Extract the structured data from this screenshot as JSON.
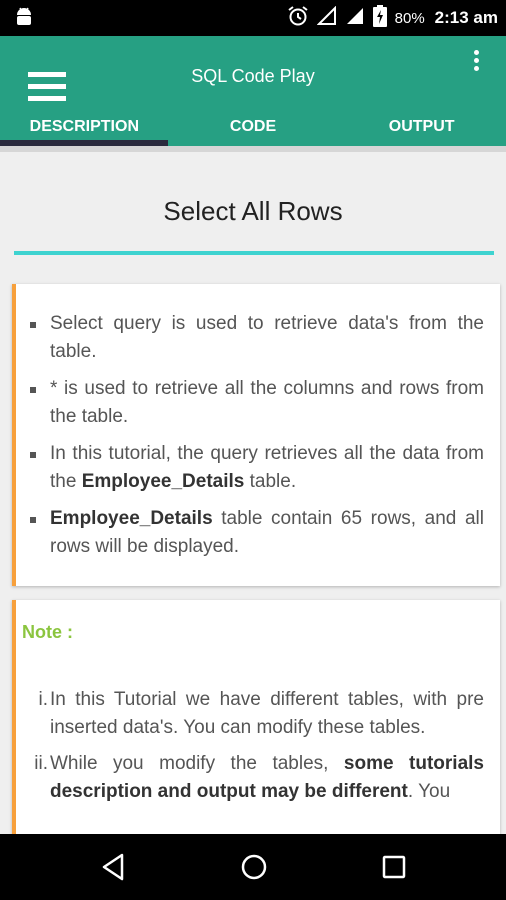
{
  "status": {
    "battery_pct": "80%",
    "time": "2:13 am"
  },
  "app": {
    "title": "SQL Code Play"
  },
  "tabs": [
    {
      "label": "DESCRIPTION",
      "active": true
    },
    {
      "label": "CODE",
      "active": false
    },
    {
      "label": "OUTPUT",
      "active": false
    }
  ],
  "page": {
    "heading": "Select All Rows"
  },
  "description": {
    "bullets": [
      {
        "pre": "Select query is used to retrieve data's from the table.",
        "bold": "",
        "post": ""
      },
      {
        "pre": "* is used to retrieve all the columns and rows from the table.",
        "bold": "",
        "post": ""
      },
      {
        "pre": "In this tutorial, the query retrieves all the data from the ",
        "bold": "Employee_Details",
        "post": " table."
      },
      {
        "pre": "",
        "bold": "Employee_Details",
        "post": " table contain 65 rows, and all rows will be displayed."
      }
    ]
  },
  "note": {
    "label": "Note :",
    "items": [
      {
        "num": "i.",
        "pre": "In this Tutorial we have different tables, with pre inserted data's. You can modify these tables.",
        "bold": "",
        "post": ""
      },
      {
        "num": "ii.",
        "pre": "While you modify the tables, ",
        "bold": "some tutorials description and output may be different",
        "post": ". You"
      }
    ]
  },
  "colors": {
    "appbar": "#26a083",
    "accent_rule": "#3ed3d0",
    "card_border": "#f7a03c",
    "note_label": "#8bc53f",
    "tab_indicator": "#2a2a3d"
  },
  "icons": {
    "status_left": "android-icon",
    "status_right": [
      "alarm-icon",
      "signal-icon",
      "signal-icon",
      "battery-charging-icon"
    ],
    "appbar": [
      "menu-icon",
      "more-vert-icon"
    ],
    "nav": [
      "back-icon",
      "home-icon",
      "recents-icon"
    ]
  }
}
